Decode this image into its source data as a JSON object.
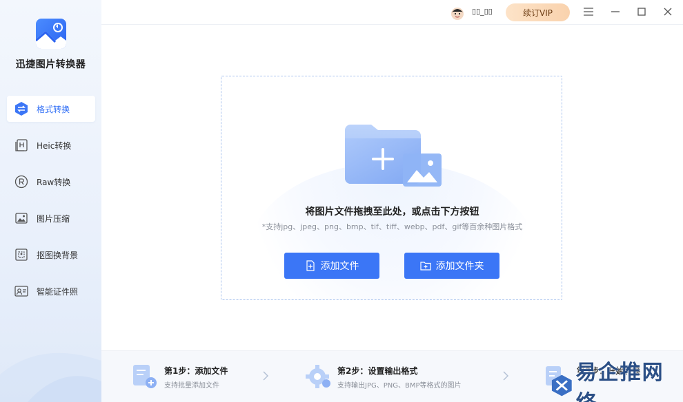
{
  "app": {
    "title": "迅捷图片转换器"
  },
  "sidebar": {
    "items": [
      {
        "label": "格式转换",
        "icon": "format-convert-icon",
        "active": true
      },
      {
        "label": "Heic转换",
        "icon": "heic-icon",
        "active": false
      },
      {
        "label": "Raw转换",
        "icon": "raw-icon",
        "active": false
      },
      {
        "label": "图片压缩",
        "icon": "image-compress-icon",
        "active": false
      },
      {
        "label": "抠图换背景",
        "icon": "cutout-icon",
        "active": false
      },
      {
        "label": "智能证件照",
        "icon": "id-photo-icon",
        "active": false
      }
    ]
  },
  "topbar": {
    "username": "▯▯_▯▯",
    "vip_label": "续订VIP"
  },
  "dropzone": {
    "title": "将图片文件拖拽至此处，或点击下方按钮",
    "subtitle": "*支持jpg、jpeg、png、bmp、tif、tiff、webp、pdf、gif等百余种图片格式",
    "add_file_label": "添加文件",
    "add_folder_label": "添加文件夹"
  },
  "steps": [
    {
      "title": "第1步：添加文件",
      "desc": "支持批量添加文件"
    },
    {
      "title": "第2步：设置输出格式",
      "desc": "支持输出JPG、PNG、BMP等格式的图片"
    },
    {
      "title": "第3步：开始转换",
      "desc": ""
    }
  ],
  "watermark": {
    "text": "易企推网络"
  },
  "colors": {
    "accent": "#3b76f6",
    "vip": "#f9d2ad",
    "sidebar": "#eef3fb"
  }
}
